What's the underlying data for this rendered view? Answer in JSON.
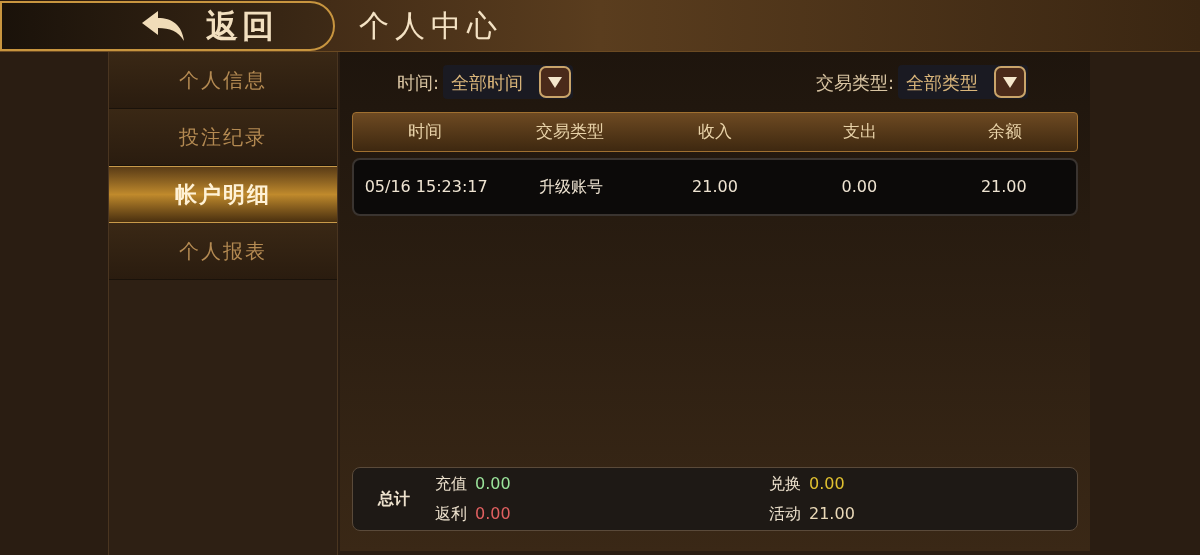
{
  "header": {
    "back_label": "返回",
    "title": "个人中心"
  },
  "sidebar": {
    "items": [
      {
        "label": "个人信息",
        "selected": false
      },
      {
        "label": "投注纪录",
        "selected": false
      },
      {
        "label": "帐户明细",
        "selected": true
      },
      {
        "label": "个人报表",
        "selected": false
      }
    ]
  },
  "filters": [
    {
      "label": "时间:",
      "value": "全部时间"
    },
    {
      "label": "交易类型:",
      "value": "全部类型"
    }
  ],
  "table": {
    "columns": [
      "时间",
      "交易类型",
      "收入",
      "支出",
      "余额"
    ],
    "rows": [
      [
        "05/16 15:23:17",
        "升级账号",
        "21.00",
        "0.00",
        "21.00"
      ]
    ]
  },
  "summary": {
    "label": "总计",
    "items": [
      {
        "label": "充值",
        "value": "0.00",
        "color": "#9be39b"
      },
      {
        "label": "兑换",
        "value": "0.00",
        "color": "#e0c030"
      },
      {
        "label": "返利",
        "value": "0.00",
        "color": "#e06060"
      },
      {
        "label": "活动",
        "value": "21.00",
        "color": "#ead9b8"
      }
    ]
  }
}
